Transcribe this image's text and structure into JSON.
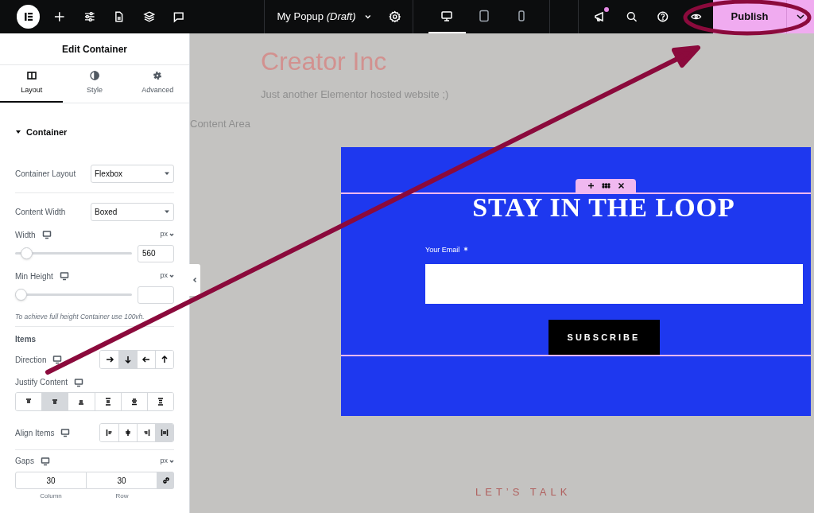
{
  "toolbar": {
    "document_title": "My Popup *(Draft)*",
    "devices": [
      {
        "kind": "desktop",
        "selected": true
      },
      {
        "kind": "tablet",
        "selected": false
      },
      {
        "kind": "mobile",
        "selected": false
      }
    ],
    "announcements_unread": true,
    "publish_label": "Publish"
  },
  "panel": {
    "title": "Edit Container",
    "tabs": [
      {
        "kind": "layout",
        "label": "Layout",
        "selected": true
      },
      {
        "kind": "style",
        "label": "Style",
        "selected": false
      },
      {
        "kind": "advanced",
        "label": "Advanced",
        "selected": false
      }
    ],
    "section": {
      "title": "Container",
      "expanded": true
    },
    "controls": [
      {
        "kind": "select",
        "label": "Container Layout",
        "value": "Flexbox"
      },
      {
        "kind": "divider"
      },
      {
        "kind": "select",
        "label": "Content Width",
        "value": "Boxed"
      },
      {
        "kind": "slider",
        "label": "Width",
        "unit": "px",
        "level": 0.05,
        "value": "560"
      },
      {
        "kind": "slider",
        "label": "Min Height",
        "unit": "px",
        "level": 0
      },
      {
        "kind": "note",
        "text": "To achieve full height Container use 100vh."
      },
      {
        "kind": "divider"
      },
      {
        "kind": "heading",
        "text": "Items"
      },
      {
        "kind": "choices",
        "label": "Direction",
        "options": [
          {
            "kind": "right",
            "selected": false
          },
          {
            "kind": "down",
            "selected": true
          },
          {
            "kind": "left",
            "selected": false
          },
          {
            "kind": "up",
            "selected": false
          }
        ]
      },
      {
        "kind": "wide_choices",
        "label": "Justify Content",
        "options": [
          {
            "kind": "start",
            "selected": false
          },
          {
            "kind": "center",
            "selected": true
          },
          {
            "kind": "end",
            "selected": false
          },
          {
            "kind": "between",
            "selected": false
          },
          {
            "kind": "around",
            "selected": false
          },
          {
            "kind": "evenly",
            "selected": false
          }
        ]
      },
      {
        "kind": "choices",
        "label": "Align Items",
        "options": [
          {
            "kind": "a-start",
            "selected": false
          },
          {
            "kind": "a-center",
            "selected": false
          },
          {
            "kind": "a-end",
            "selected": false
          },
          {
            "kind": "a-stretch",
            "selected": true
          }
        ]
      },
      {
        "kind": "divider"
      },
      {
        "kind": "gaps",
        "label": "Gaps",
        "unit": "px",
        "column": "30",
        "row": "30",
        "column_label": "Column",
        "row_label": "Row",
        "linked": true
      }
    ]
  },
  "canvas": {
    "site_title": "Creator Inc",
    "tagline": "Just another Elementor hosted website ;)",
    "content_label": "Content Area",
    "popup": {
      "heading": "STAY IN THE LOOP",
      "email_label": "Your Email",
      "required": true,
      "button": "SUBSCRIBE"
    },
    "footer_text": "LET’S TALK"
  }
}
